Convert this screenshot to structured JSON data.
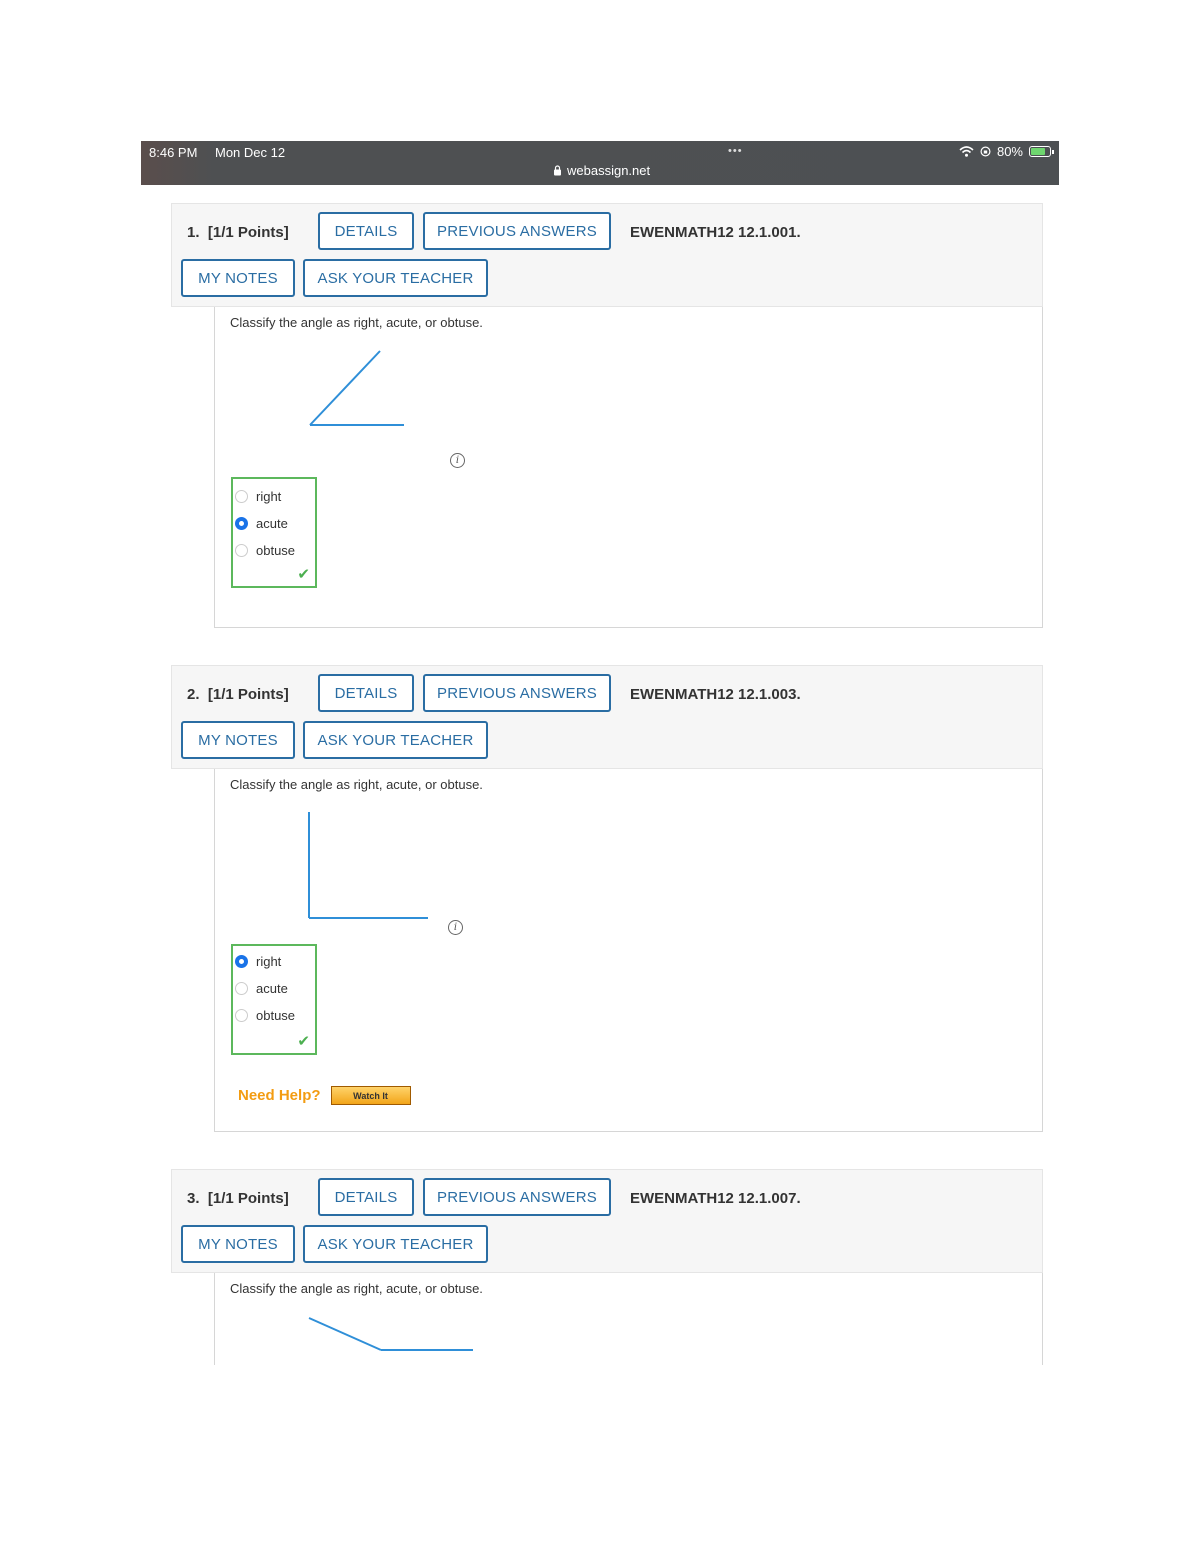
{
  "status_bar": {
    "time": "8:46 PM",
    "date": "Mon Dec 12",
    "dots": "•••",
    "url": "webassign.net",
    "battery": "80%"
  },
  "questions": [
    {
      "number": "1.",
      "points": "[1/1 Points]",
      "details_label": "DETAILS",
      "previous_label": "PREVIOUS ANSWERS",
      "code": "EWENMATH12 12.1.001.",
      "notes_label": "MY NOTES",
      "ask_label": "ASK YOUR TEACHER",
      "prompt": "Classify the angle as right, acute, or obtuse.",
      "choices": [
        "right",
        "acute",
        "obtuse"
      ],
      "selected": "acute"
    },
    {
      "number": "2.",
      "points": "[1/1 Points]",
      "details_label": "DETAILS",
      "previous_label": "PREVIOUS ANSWERS",
      "code": "EWENMATH12 12.1.003.",
      "notes_label": "MY NOTES",
      "ask_label": "ASK YOUR TEACHER",
      "prompt": "Classify the angle as right, acute, or obtuse.",
      "choices": [
        "right",
        "acute",
        "obtuse"
      ],
      "selected": "right",
      "help_label": "Need Help?",
      "watch_label": "Watch It"
    },
    {
      "number": "3.",
      "points": "[1/1 Points]",
      "details_label": "DETAILS",
      "previous_label": "PREVIOUS ANSWERS",
      "code": "EWENMATH12 12.1.007.",
      "notes_label": "MY NOTES",
      "ask_label": "ASK YOUR TEACHER",
      "prompt": "Classify the angle as right, acute, or obtuse."
    }
  ],
  "colors": {
    "accent": "#2a6da3",
    "correct": "#5cb85c",
    "help": "#f39c12",
    "angle_line": "#2f8fd8"
  }
}
